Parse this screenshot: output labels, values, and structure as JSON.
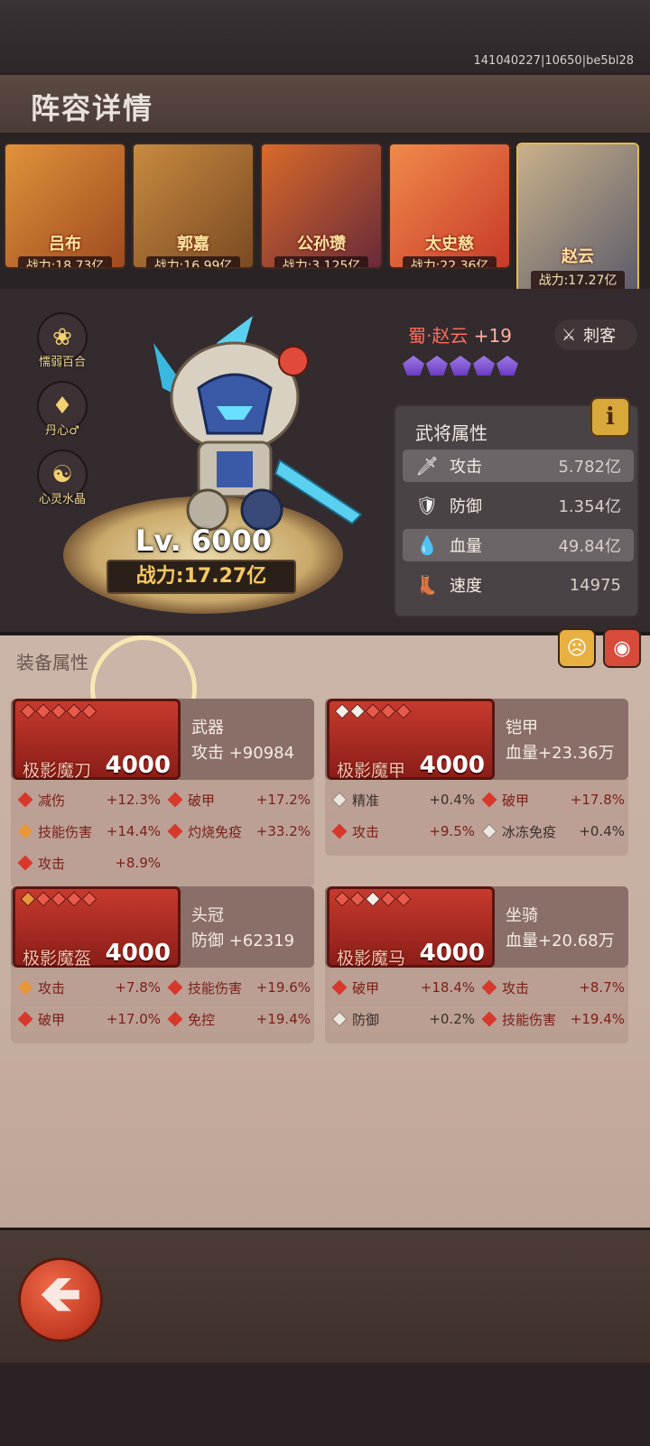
{
  "build_id": "141040227|10650|be5bl28",
  "page_title": "阵容详情",
  "heroes": [
    {
      "name": "吕布",
      "power": "战力:18.73亿",
      "colors": [
        "#e0923a",
        "#a04a20"
      ]
    },
    {
      "name": "郭嘉",
      "power": "战力:16.99亿",
      "colors": [
        "#c88a40",
        "#7a4a22"
      ]
    },
    {
      "name": "公孙瓒",
      "power": "战力:3.125亿",
      "colors": [
        "#d86a2a",
        "#6a2a3a"
      ]
    },
    {
      "name": "太史慈",
      "power": "战力:22.36亿",
      "colors": [
        "#f08a4a",
        "#c83a2a"
      ]
    },
    {
      "name": "赵云",
      "power": "战力:17.27亿",
      "colors": [
        "#c8b08a",
        "#5a5a6a"
      ],
      "selected": true
    }
  ],
  "side_badges": [
    {
      "label": "懦弱百合",
      "icon": "lily-flower-icon",
      "glyph": "❀"
    },
    {
      "label": "丹心♂",
      "icon": "heart-core-icon",
      "glyph": "♦"
    },
    {
      "label": "心灵水晶",
      "icon": "mind-crystal-icon",
      "glyph": "☯"
    }
  ],
  "hero_detail": {
    "name": "蜀·赵云",
    "plus": "+19",
    "class": "刺客",
    "level": "Lv. 6000",
    "power": "战力:17.27亿",
    "star_count": 5
  },
  "stats": {
    "header": "武将属性",
    "info": "i",
    "rows": [
      {
        "name": "攻击",
        "value": "5.782亿",
        "icon": "sword-icon",
        "glyph": "🗡"
      },
      {
        "name": "防御",
        "value": "1.354亿",
        "icon": "shield-icon",
        "glyph": "🛡"
      },
      {
        "name": "血量",
        "value": "49.84亿",
        "icon": "blood-drop-icon",
        "glyph": "💧"
      },
      {
        "name": "速度",
        "value": "14975",
        "icon": "boot-icon",
        "glyph": "👢"
      }
    ]
  },
  "gear": {
    "title": "装备属性",
    "items": [
      {
        "type": "武器",
        "main": "攻击  +90984",
        "name": "极影魔刀",
        "level": "4000",
        "diamonds": [
          "r",
          "r",
          "r",
          "r",
          "r"
        ],
        "subs": [
          {
            "n": "减伤",
            "v": "+12.3%",
            "c": "r"
          },
          {
            "n": "破甲",
            "v": "+17.2%",
            "c": "r"
          },
          {
            "n": "技能伤害",
            "v": "+14.4%",
            "c": "o"
          },
          {
            "n": "灼烧免疫",
            "v": "+33.2%",
            "c": "r"
          },
          {
            "n": "攻击",
            "v": "+8.9%",
            "c": "r"
          }
        ]
      },
      {
        "type": "铠甲",
        "main": "血量+23.36万",
        "name": "极影魔甲",
        "level": "4000",
        "diamonds": [
          "w",
          "w",
          "r",
          "r",
          "r"
        ],
        "subs": [
          {
            "n": "精准",
            "v": "+0.4%",
            "c": "w"
          },
          {
            "n": "破甲",
            "v": "+17.8%",
            "c": "r"
          },
          {
            "n": "攻击",
            "v": "+9.5%",
            "c": "r"
          },
          {
            "n": "冰冻免疫",
            "v": "+0.4%",
            "c": "w"
          }
        ]
      },
      {
        "type": "头冠",
        "main": "防御  +62319",
        "name": "极影魔盔",
        "level": "4000",
        "diamonds": [
          "o",
          "r",
          "r",
          "r",
          "r"
        ],
        "subs": [
          {
            "n": "攻击",
            "v": "+7.8%",
            "c": "o"
          },
          {
            "n": "技能伤害",
            "v": "+19.6%",
            "c": "r"
          },
          {
            "n": "破甲",
            "v": "+17.0%",
            "c": "r"
          },
          {
            "n": "免控",
            "v": "+19.4%",
            "c": "r"
          }
        ]
      },
      {
        "type": "坐骑",
        "main": "血量+20.68万",
        "name": "极影魔马",
        "level": "4000",
        "diamonds": [
          "r",
          "r",
          "w",
          "r",
          "r"
        ],
        "subs": [
          {
            "n": "破甲",
            "v": "+18.4%",
            "c": "r"
          },
          {
            "n": "攻击",
            "v": "+8.7%",
            "c": "r"
          },
          {
            "n": "防御",
            "v": "+0.2%",
            "c": "w"
          },
          {
            "n": "技能伤害",
            "v": "+19.4%",
            "c": "r"
          }
        ]
      }
    ]
  },
  "back_label": "🡸"
}
